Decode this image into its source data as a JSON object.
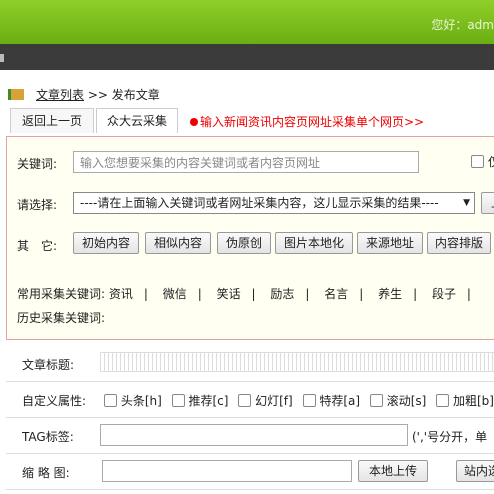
{
  "header": {
    "greeting": "您好：adm"
  },
  "breadcrumb": {
    "list_link": "文章列表",
    "sep": ">>",
    "current": "发布文章"
  },
  "tabs": [
    {
      "label": "返回上一页"
    },
    {
      "label": "众大云采集"
    }
  ],
  "tab_note": "输入新闻资讯内容页网址采集单个网页>>",
  "collect": {
    "keyword_label": "关键词:",
    "keyword_placeholder": "输入您想要采集的内容关键词或者内容页网址",
    "option_label": "仅",
    "select_label": "请选择:",
    "select_value": "----请在上面输入关键词或者网址采集内容，这儿显示采集的结果----",
    "side_btn": "上",
    "other_label": "其　它:",
    "buttons": [
      "初始内容",
      "相似内容",
      "伪原创",
      "图片本地化",
      "来源地址",
      "内容排版"
    ],
    "common_label": "常用采集关键词:",
    "common_keywords": [
      "资讯",
      "微信",
      "笑话",
      "励志",
      "名言",
      "养生",
      "段子"
    ],
    "history_label": "历史采集关键词:"
  },
  "form": {
    "title_label": "文章标题:",
    "attr_label": "自定义属性:",
    "attrs": [
      "头条[h]",
      "推荐[c]",
      "幻灯[f]",
      "特荐[a]",
      "滚动[s]",
      "加粗[b]"
    ],
    "tag_label": "TAG标签:",
    "tag_hint": "(','号分开，单",
    "thumb_label": "缩 略 图:",
    "upload_btn": "本地上传",
    "site_btn": "站内选"
  }
}
